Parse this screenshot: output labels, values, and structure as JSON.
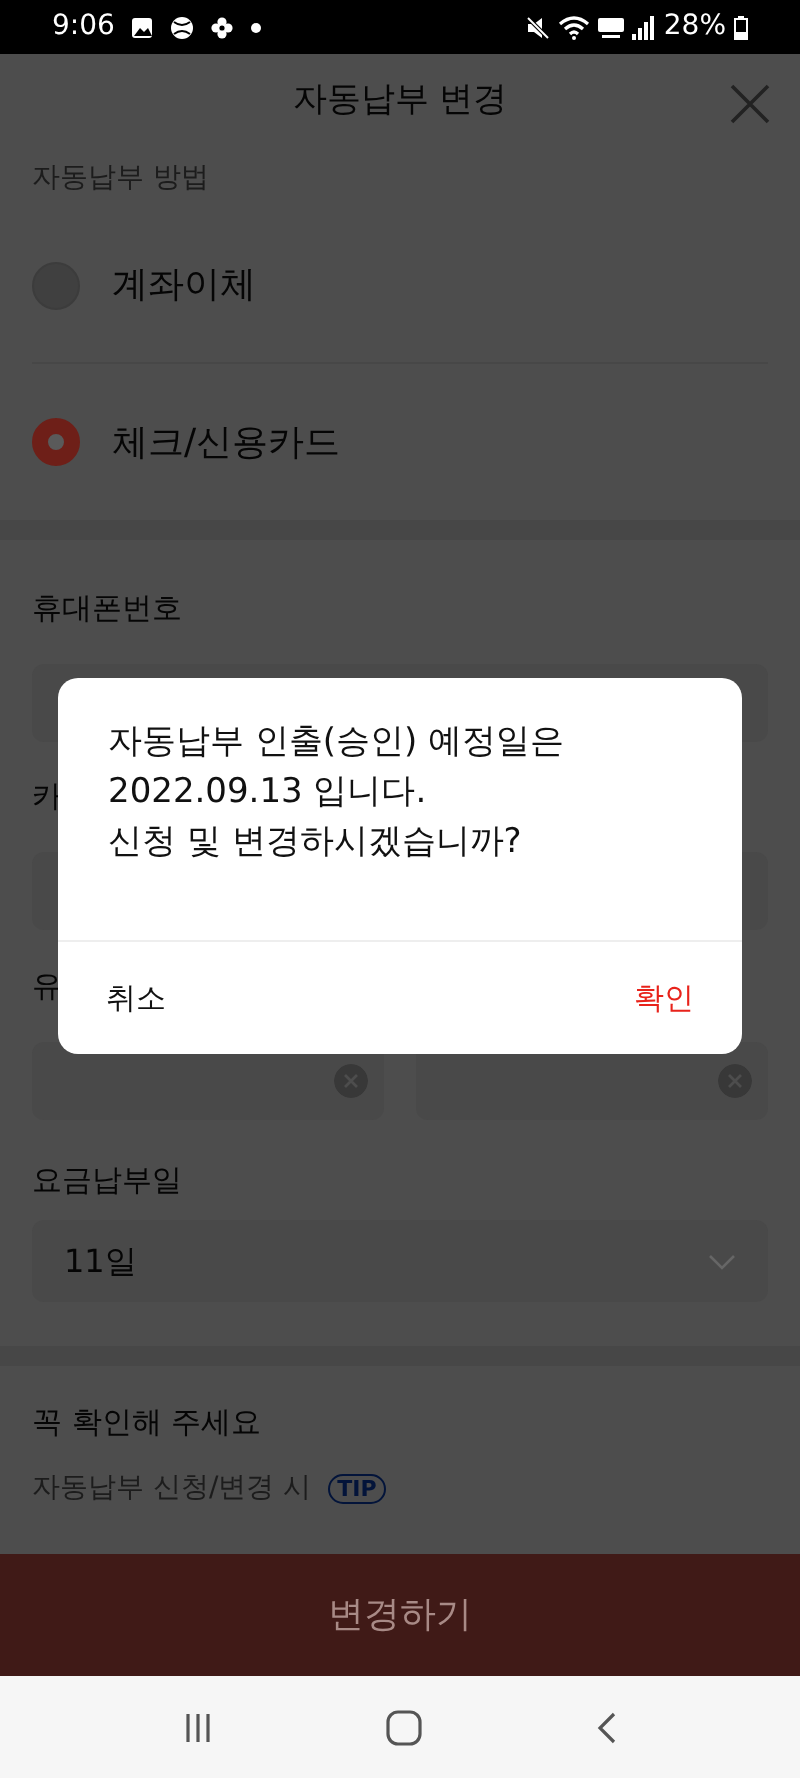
{
  "status_bar": {
    "time": "9:06",
    "battery": "28%"
  },
  "header": {
    "title": "자동납부 변경"
  },
  "payment_method": {
    "label": "자동납부 방법",
    "options": [
      {
        "label": "계좌이체",
        "selected": false
      },
      {
        "label": "체크/신용카드",
        "selected": true
      }
    ]
  },
  "fields": [
    {
      "label": "휴대폰번호",
      "kind": "single"
    },
    {
      "label": "카",
      "kind": "single"
    },
    {
      "label": "유",
      "kind": "pair"
    }
  ],
  "billing_day": {
    "label": "요금납부일",
    "value": "11일"
  },
  "notice": {
    "title": "꼭 확인해 주세요",
    "items": [
      {
        "text": "자동납부 신청/변경 시",
        "badge": "TIP"
      }
    ]
  },
  "submit_button": "변경하기",
  "dialog": {
    "message": "자동납부 인출(승인) 예정일은\n2022.09.13 입니다.\n신청 및 변경하시겠습니까?",
    "buttons": [
      {
        "label": "취소",
        "kind": "cancel"
      },
      {
        "label": "확인",
        "kind": "confirm"
      }
    ]
  }
}
